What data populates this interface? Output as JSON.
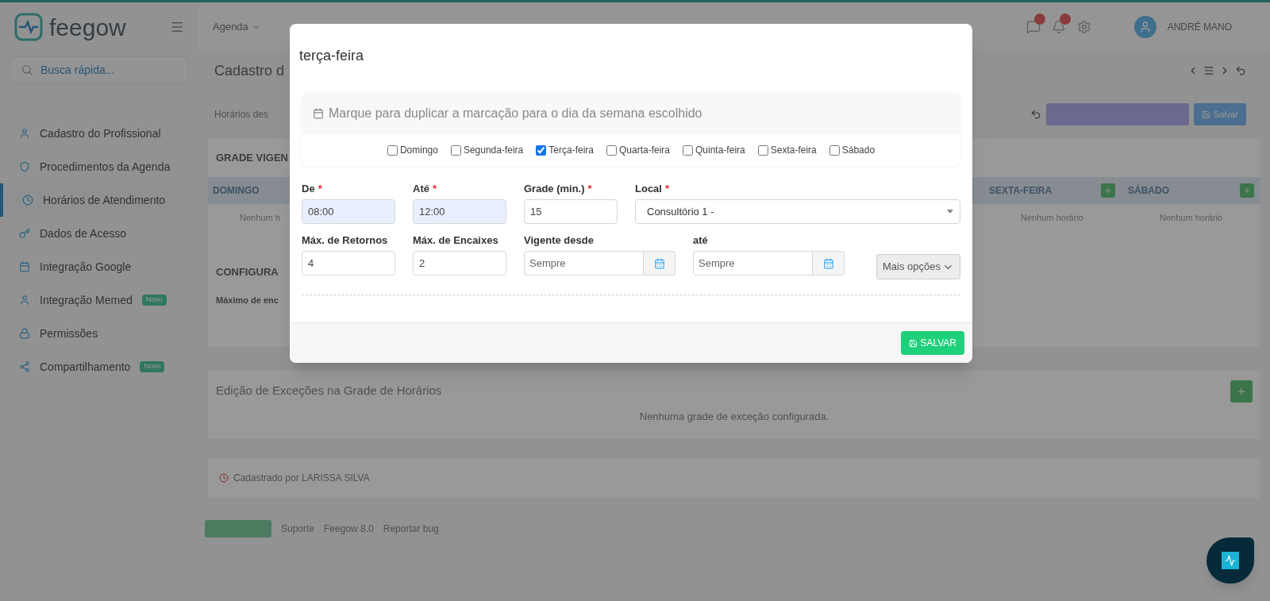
{
  "topbar": {
    "logo": "feegow",
    "nav": [
      {
        "label": "Agenda"
      }
    ],
    "user_name": "ANDRÉ MANO"
  },
  "sidebar": {
    "search": {
      "placeholder": "Busca rápida..."
    },
    "items": [
      {
        "label": "Cadastro do Profissional",
        "selected": false
      },
      {
        "label": "Procedimentos da Agenda",
        "selected": false
      },
      {
        "label": "Horários de Atendimento",
        "selected": true
      },
      {
        "label": "Dados de Acesso",
        "selected": false
      },
      {
        "label": "Integração Google",
        "selected": false
      },
      {
        "label": "Integração Memed",
        "selected": false,
        "badge": "Novo"
      },
      {
        "label": "Permissões",
        "selected": false
      },
      {
        "label": "Compartilhamento",
        "selected": false,
        "badge": "Novo"
      }
    ]
  },
  "page": {
    "title": "Cadastro d",
    "subtitle": "Horários des",
    "save_button": "Salvar",
    "grade_title": "GRADE VIGEN",
    "left_columns": [
      {
        "day": "DOMINGO",
        "empty": "Nenhum h"
      }
    ],
    "right_columns": [
      {
        "day": "SEXTA-FEIRA",
        "empty": "Nenhum horário"
      },
      {
        "day": "SÁBADO",
        "empty": "Nenhum horário"
      }
    ],
    "config_title": "CONFIGURA",
    "config_label": "Máximo de enc",
    "exceptions": {
      "title": "Edição de Exceções na Grade de Horários",
      "empty": "Nenhuma grade de exceção configurada."
    },
    "created_by": "Cadastrado por LARISSA SILVA",
    "footer": [
      "Suporte",
      "Feegow 8.0",
      "Reportar bug"
    ]
  },
  "modal": {
    "title": "terça-feira",
    "info": "Marque para duplicar a marcação para o dia da semana escolhido",
    "days": [
      {
        "label": "Domingo",
        "checked": false
      },
      {
        "label": "Segunda-feira",
        "checked": false
      },
      {
        "label": "Terça-feira",
        "checked": true
      },
      {
        "label": "Quarta-feira",
        "checked": false
      },
      {
        "label": "Quinta-feira",
        "checked": false
      },
      {
        "label": "Sexta-feira",
        "checked": false
      },
      {
        "label": "Sábado",
        "checked": false
      }
    ],
    "row1": [
      {
        "kind": "text",
        "label": "De",
        "required_mark": "*",
        "value": "08:00",
        "autofilled": true
      },
      {
        "kind": "text",
        "label": "Até",
        "required_mark": "*",
        "value": "12:00",
        "autofilled": true
      },
      {
        "kind": "text",
        "label": "Grade (min.)",
        "required_mark": "*",
        "value": "15",
        "autofilled": false
      },
      {
        "kind": "select",
        "label": "Local",
        "required_mark": "*",
        "value": "Consultório 1 -",
        "autofilled": false
      }
    ],
    "row2": [
      {
        "kind": "text",
        "label": "Máx. de Retornos",
        "value": "4",
        "autofilled": false
      },
      {
        "kind": "text",
        "label": "Máx. de Encaixes",
        "value": "2",
        "autofilled": false
      },
      {
        "kind": "date",
        "label": "Vigente desde",
        "placeholder": "Sempre",
        "autofilled": false
      },
      {
        "kind": "date",
        "label": "até",
        "placeholder": "Sempre",
        "autofilled": false
      }
    ],
    "more_button": "Mais opções",
    "save_button": "SALVAR"
  }
}
